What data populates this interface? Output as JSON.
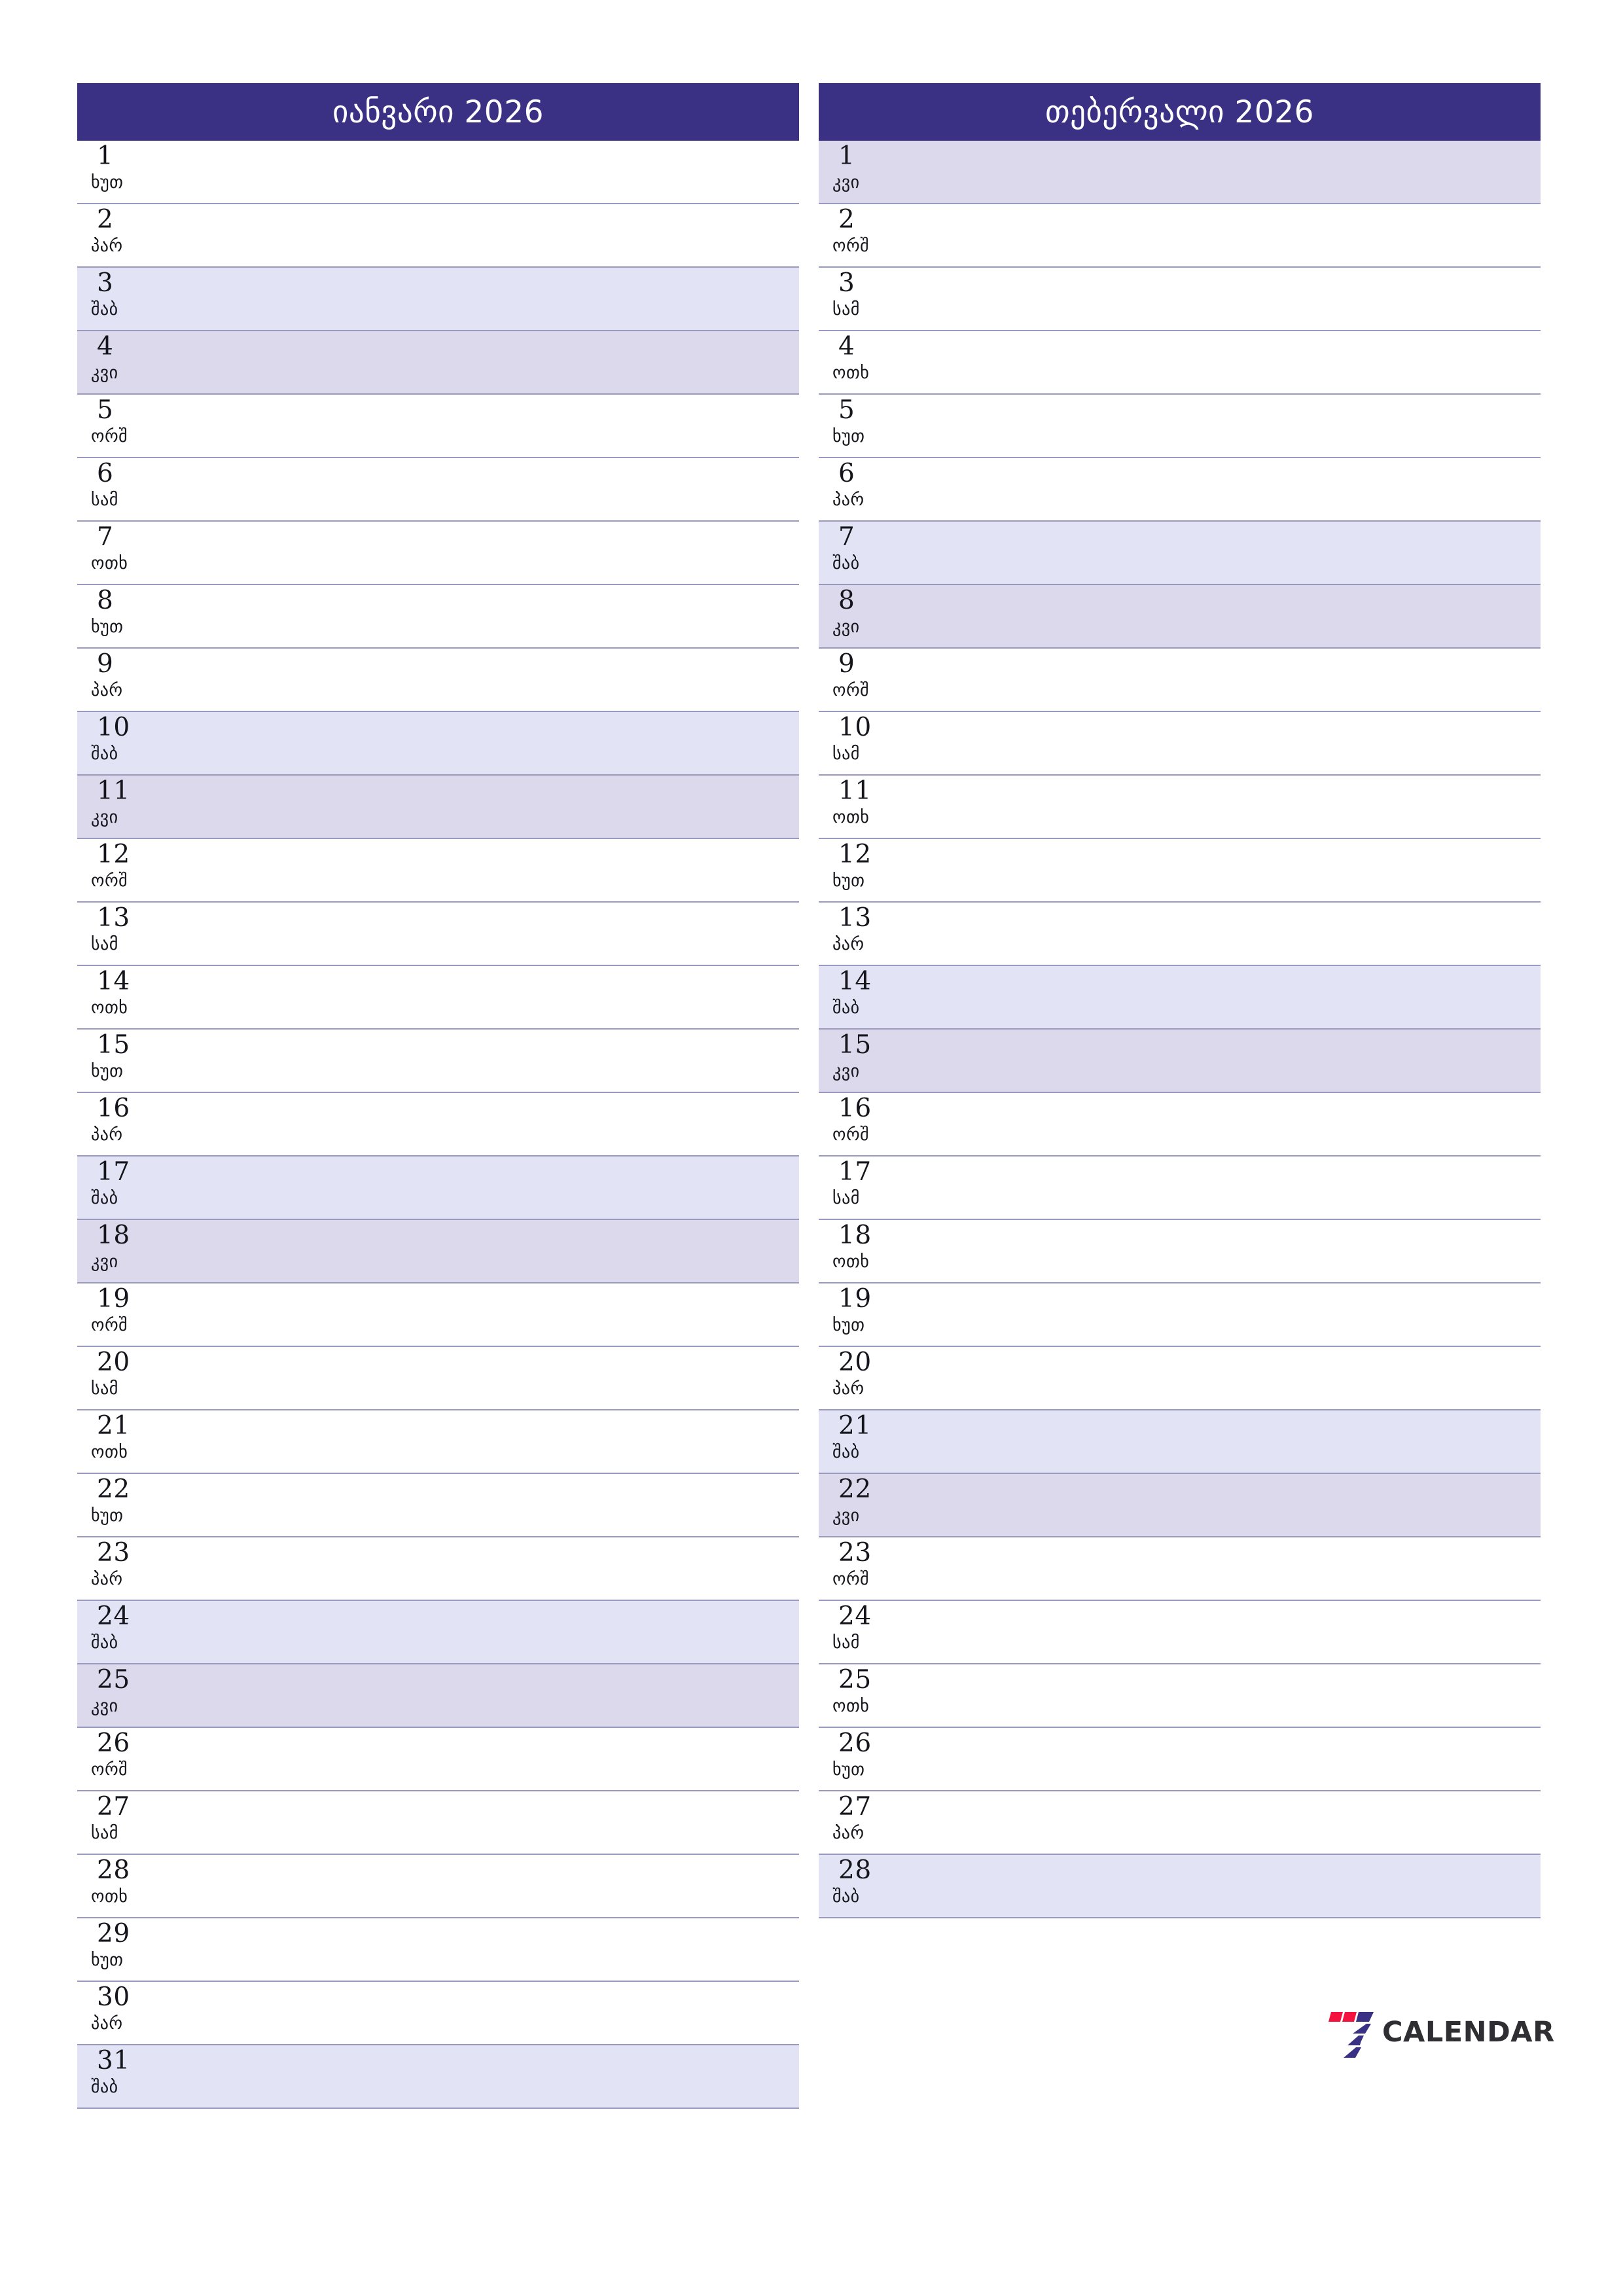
{
  "page": {
    "background": "#ffffff",
    "accent_header": "#3a3185",
    "saturday_bg": "#e3e3f6",
    "sunday_bg": "#dcd9ec",
    "row_border": "#9a99bf",
    "text_color": "#15151c"
  },
  "logo": {
    "word": "CALENDAR",
    "mark_name": "seven-bars-logo",
    "color_red": "#f4133f",
    "color_navy": "#3a3185",
    "word_color": "#2f2f33"
  },
  "months": [
    {
      "title": "იანვარი 2026",
      "days": [
        {
          "num": "1",
          "weekday": "ხუთ",
          "kind": "weekday"
        },
        {
          "num": "2",
          "weekday": "პარ",
          "kind": "weekday"
        },
        {
          "num": "3",
          "weekday": "შაბ",
          "kind": "sat"
        },
        {
          "num": "4",
          "weekday": "კვი",
          "kind": "sun"
        },
        {
          "num": "5",
          "weekday": "ორშ",
          "kind": "weekday"
        },
        {
          "num": "6",
          "weekday": "სამ",
          "kind": "weekday"
        },
        {
          "num": "7",
          "weekday": "ოთხ",
          "kind": "weekday"
        },
        {
          "num": "8",
          "weekday": "ხუთ",
          "kind": "weekday"
        },
        {
          "num": "9",
          "weekday": "პარ",
          "kind": "weekday"
        },
        {
          "num": "10",
          "weekday": "შაბ",
          "kind": "sat"
        },
        {
          "num": "11",
          "weekday": "კვი",
          "kind": "sun"
        },
        {
          "num": "12",
          "weekday": "ორშ",
          "kind": "weekday"
        },
        {
          "num": "13",
          "weekday": "სამ",
          "kind": "weekday"
        },
        {
          "num": "14",
          "weekday": "ოთხ",
          "kind": "weekday"
        },
        {
          "num": "15",
          "weekday": "ხუთ",
          "kind": "weekday"
        },
        {
          "num": "16",
          "weekday": "პარ",
          "kind": "weekday"
        },
        {
          "num": "17",
          "weekday": "შაბ",
          "kind": "sat"
        },
        {
          "num": "18",
          "weekday": "კვი",
          "kind": "sun"
        },
        {
          "num": "19",
          "weekday": "ორშ",
          "kind": "weekday"
        },
        {
          "num": "20",
          "weekday": "სამ",
          "kind": "weekday"
        },
        {
          "num": "21",
          "weekday": "ოთხ",
          "kind": "weekday"
        },
        {
          "num": "22",
          "weekday": "ხუთ",
          "kind": "weekday"
        },
        {
          "num": "23",
          "weekday": "პარ",
          "kind": "weekday"
        },
        {
          "num": "24",
          "weekday": "შაბ",
          "kind": "sat"
        },
        {
          "num": "25",
          "weekday": "კვი",
          "kind": "sun"
        },
        {
          "num": "26",
          "weekday": "ორშ",
          "kind": "weekday"
        },
        {
          "num": "27",
          "weekday": "სამ",
          "kind": "weekday"
        },
        {
          "num": "28",
          "weekday": "ოთხ",
          "kind": "weekday"
        },
        {
          "num": "29",
          "weekday": "ხუთ",
          "kind": "weekday"
        },
        {
          "num": "30",
          "weekday": "პარ",
          "kind": "weekday"
        },
        {
          "num": "31",
          "weekday": "შაბ",
          "kind": "sat"
        }
      ]
    },
    {
      "title": "თებერვალი 2026",
      "days": [
        {
          "num": "1",
          "weekday": "კვი",
          "kind": "sun"
        },
        {
          "num": "2",
          "weekday": "ორშ",
          "kind": "weekday"
        },
        {
          "num": "3",
          "weekday": "სამ",
          "kind": "weekday"
        },
        {
          "num": "4",
          "weekday": "ოთხ",
          "kind": "weekday"
        },
        {
          "num": "5",
          "weekday": "ხუთ",
          "kind": "weekday"
        },
        {
          "num": "6",
          "weekday": "პარ",
          "kind": "weekday"
        },
        {
          "num": "7",
          "weekday": "შაბ",
          "kind": "sat"
        },
        {
          "num": "8",
          "weekday": "კვი",
          "kind": "sun"
        },
        {
          "num": "9",
          "weekday": "ორშ",
          "kind": "weekday"
        },
        {
          "num": "10",
          "weekday": "სამ",
          "kind": "weekday"
        },
        {
          "num": "11",
          "weekday": "ოთხ",
          "kind": "weekday"
        },
        {
          "num": "12",
          "weekday": "ხუთ",
          "kind": "weekday"
        },
        {
          "num": "13",
          "weekday": "პარ",
          "kind": "weekday"
        },
        {
          "num": "14",
          "weekday": "შაბ",
          "kind": "sat"
        },
        {
          "num": "15",
          "weekday": "კვი",
          "kind": "sun"
        },
        {
          "num": "16",
          "weekday": "ორშ",
          "kind": "weekday"
        },
        {
          "num": "17",
          "weekday": "სამ",
          "kind": "weekday"
        },
        {
          "num": "18",
          "weekday": "ოთხ",
          "kind": "weekday"
        },
        {
          "num": "19",
          "weekday": "ხუთ",
          "kind": "weekday"
        },
        {
          "num": "20",
          "weekday": "პარ",
          "kind": "weekday"
        },
        {
          "num": "21",
          "weekday": "შაბ",
          "kind": "sat"
        },
        {
          "num": "22",
          "weekday": "კვი",
          "kind": "sun"
        },
        {
          "num": "23",
          "weekday": "ორშ",
          "kind": "weekday"
        },
        {
          "num": "24",
          "weekday": "სამ",
          "kind": "weekday"
        },
        {
          "num": "25",
          "weekday": "ოთხ",
          "kind": "weekday"
        },
        {
          "num": "26",
          "weekday": "ხუთ",
          "kind": "weekday"
        },
        {
          "num": "27",
          "weekday": "პარ",
          "kind": "weekday"
        },
        {
          "num": "28",
          "weekday": "შაბ",
          "kind": "sat"
        }
      ]
    }
  ]
}
